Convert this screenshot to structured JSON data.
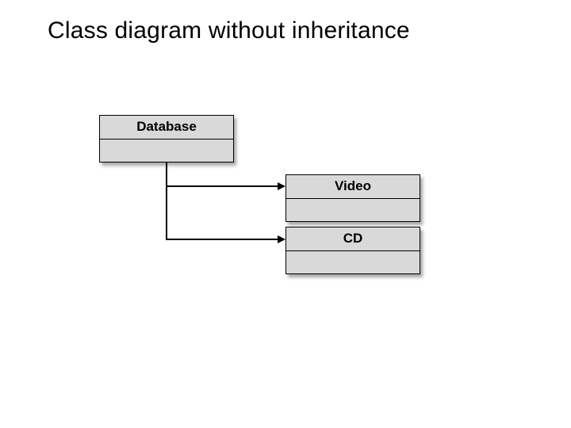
{
  "title": "Class diagram without inheritance",
  "classes": {
    "database": {
      "name": "Database"
    },
    "video": {
      "name": "Video"
    },
    "cd": {
      "name": "CD"
    }
  },
  "diagram": {
    "type": "uml-class-diagram",
    "inheritance": false,
    "nodes": [
      "Database",
      "Video",
      "CD"
    ],
    "edges": [
      {
        "from": "Database",
        "to": "Video",
        "relation": "association-directed"
      },
      {
        "from": "Database",
        "to": "CD",
        "relation": "association-directed"
      }
    ]
  }
}
